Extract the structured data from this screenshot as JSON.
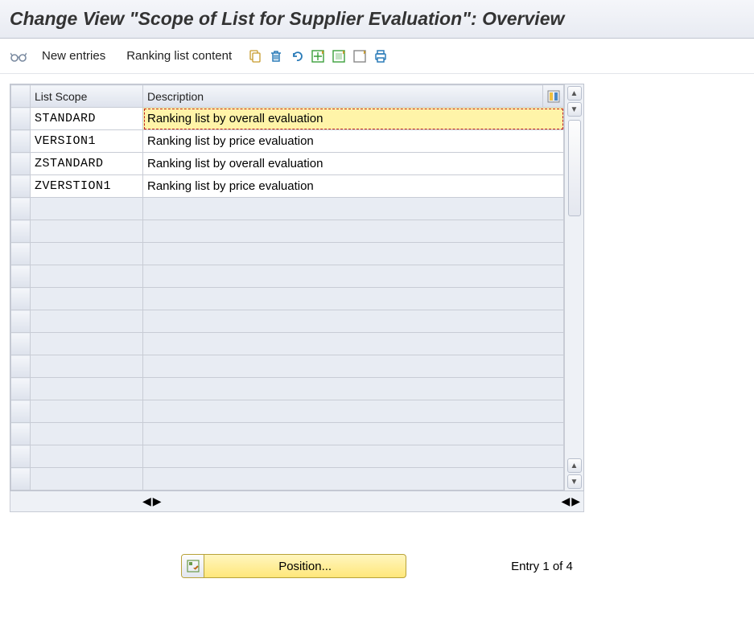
{
  "header": {
    "title": "Change View \"Scope of List for Supplier Evaluation\": Overview"
  },
  "toolbar": {
    "new_entries": "New entries",
    "ranking_list_content": "Ranking list content"
  },
  "table": {
    "columns": {
      "scope": "List Scope",
      "description": "Description"
    },
    "rows": [
      {
        "scope": "STANDARD",
        "description": "Ranking list by overall evaluation",
        "active": true
      },
      {
        "scope": "VERSION1",
        "description": "Ranking list by price evaluation",
        "active": false
      },
      {
        "scope": "ZSTANDARD",
        "description": "Ranking list by overall evaluation",
        "active": false
      },
      {
        "scope": "ZVERSTION1",
        "description": "Ranking list by price evaluation",
        "active": false
      }
    ],
    "empty_row_count": 13
  },
  "footer": {
    "position_label": "Position...",
    "entry_status": "Entry 1 of 4"
  }
}
